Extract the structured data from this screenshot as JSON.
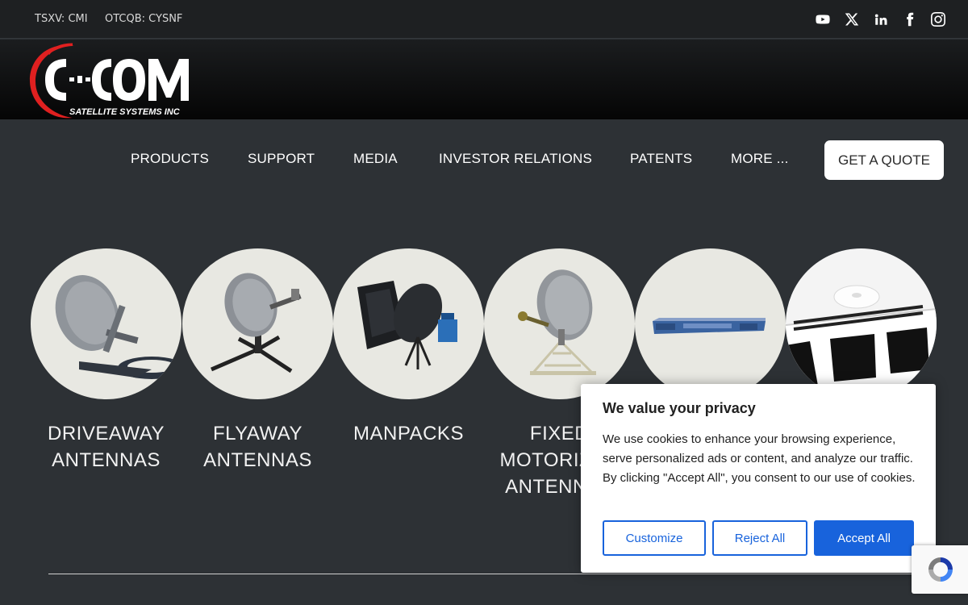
{
  "topbar": {
    "tickers": [
      "TSXV: CMI",
      "OTCQB: CYSNF"
    ],
    "social_icons": [
      "youtube-icon",
      "x-icon",
      "linkedin-icon",
      "facebook-icon",
      "instagram-icon"
    ]
  },
  "logo": {
    "name": "C-COM",
    "tagline": "SATELLITE SYSTEMS INC"
  },
  "nav": {
    "items": [
      "PRODUCTS",
      "SUPPORT",
      "MEDIA",
      "INVESTOR RELATIONS",
      "PATENTS",
      "MORE ..."
    ],
    "quote_button": "GET A QUOTE"
  },
  "products": [
    {
      "label": "DRIVEAWAY\nANTENNAS"
    },
    {
      "label": "FLYAWAY\nANTENNAS"
    },
    {
      "label": "MANPACKS"
    },
    {
      "label": "FIXED\nMOTORIZED\nANTENNAS"
    },
    {
      "label": ""
    },
    {
      "label": ""
    }
  ],
  "cookie_banner": {
    "title": "We value your privacy",
    "text": "We use cookies to enhance your browsing experience, serve personalized ads or content, and analyze our traffic. By clicking \"Accept All\", you consent to our use of cookies.",
    "customize": "Customize",
    "reject": "Reject All",
    "accept": "Accept All"
  },
  "colors": {
    "background": "#2d3135",
    "topbar": "#1e2022",
    "accent_blue": "#1863dc",
    "logo_red": "#e02020"
  }
}
